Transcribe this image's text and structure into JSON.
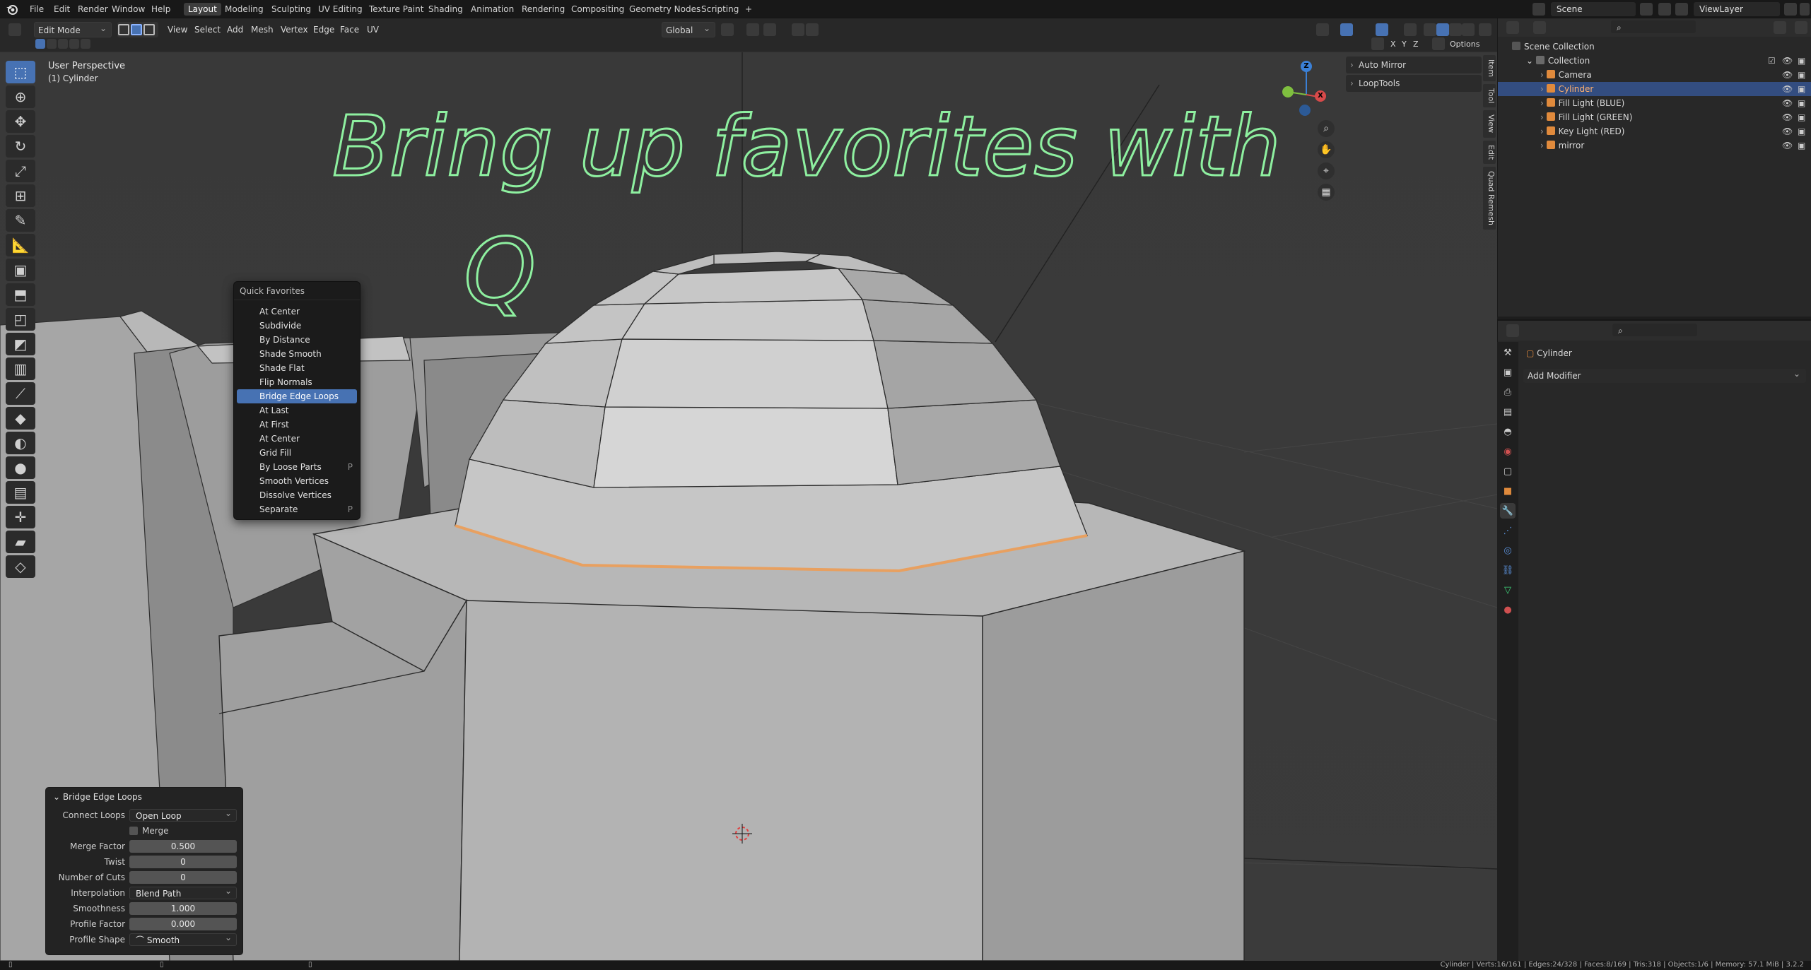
{
  "topbar": {
    "menus": [
      "File",
      "Edit",
      "Render",
      "Window",
      "Help"
    ],
    "workspaces": [
      "Layout",
      "Modeling",
      "Sculpting",
      "UV Editing",
      "Texture Paint",
      "Shading",
      "Animation",
      "Rendering",
      "Compositing",
      "Geometry Nodes",
      "Scripting"
    ],
    "add_workspace": "+",
    "scene": "Scene",
    "view_layer": "ViewLayer"
  },
  "viewport_header": {
    "mode": "Edit Mode",
    "menus": [
      "View",
      "Select",
      "Add",
      "Mesh",
      "Vertex",
      "Edge",
      "Face",
      "UV"
    ],
    "orientation": "Global",
    "mirror_axes": [
      "X",
      "Y",
      "Z"
    ],
    "options": "Options"
  },
  "viewport": {
    "perspective": "User Perspective",
    "object": "(1) Cylinder",
    "handwriting_line1": "Bring up favorites with",
    "handwriting_line2": "Q"
  },
  "quick_favorites": {
    "title": "Quick Favorites",
    "items": [
      {
        "label": "At Center",
        "shortcut": ""
      },
      {
        "label": "Subdivide",
        "shortcut": ""
      },
      {
        "label": "By Distance",
        "shortcut": ""
      },
      {
        "label": "Shade Smooth",
        "shortcut": ""
      },
      {
        "label": "Shade Flat",
        "shortcut": ""
      },
      {
        "label": "Flip Normals",
        "shortcut": ""
      },
      {
        "label": "Bridge Edge Loops",
        "shortcut": ""
      },
      {
        "label": "At Last",
        "shortcut": ""
      },
      {
        "label": "At First",
        "shortcut": ""
      },
      {
        "label": "At Center",
        "shortcut": ""
      },
      {
        "label": "Grid Fill",
        "shortcut": ""
      },
      {
        "label": "By Loose Parts",
        "shortcut": "P"
      },
      {
        "label": "Smooth Vertices",
        "shortcut": ""
      },
      {
        "label": "Dissolve Vertices",
        "shortcut": ""
      },
      {
        "label": "Separate",
        "shortcut": "P"
      }
    ],
    "highlighted_index": 6
  },
  "operator_panel": {
    "title": "Bridge Edge Loops",
    "connect_loops_label": "Connect Loops",
    "connect_loops_value": "Open Loop",
    "merge_label": "Merge",
    "merge_factor_label": "Merge Factor",
    "merge_factor_value": "0.500",
    "twist_label": "Twist",
    "twist_value": "0",
    "cuts_label": "Number of Cuts",
    "cuts_value": "0",
    "interpolation_label": "Interpolation",
    "interpolation_value": "Blend Path",
    "smoothness_label": "Smoothness",
    "smoothness_value": "1.000",
    "profile_factor_label": "Profile Factor",
    "profile_factor_value": "0.000",
    "profile_shape_label": "Profile Shape",
    "profile_shape_value": "Smooth"
  },
  "npanel": {
    "sections": [
      "Auto Mirror",
      "LoopTools"
    ],
    "tabs": [
      "Item",
      "Tool",
      "View",
      "Edit",
      "Quad Remesh"
    ]
  },
  "gizmo": {
    "x": "X",
    "y": "Y",
    "z": "Z"
  },
  "outliner": {
    "root": "Scene Collection",
    "collection": "Collection",
    "objects": [
      "Camera",
      "Cylinder",
      "Fill Light (BLUE)",
      "Fill Light (GREEN)",
      "Key Light (RED)",
      "mirror"
    ],
    "selected_index": 1
  },
  "properties": {
    "object_name": "Cylinder",
    "add_modifier": "Add Modifier"
  },
  "statusbar": {
    "stats": "Cylinder | Verts:16/161 | Edges:24/328 | Faces:8/169 | Tris:318 | Objects:1/6 | Memory: 57.1 MiB | 3.2.2"
  },
  "colors": {
    "accent": "#4772b3",
    "handwriting": "#8ef0a0",
    "selected_edge": "#e8a060"
  }
}
